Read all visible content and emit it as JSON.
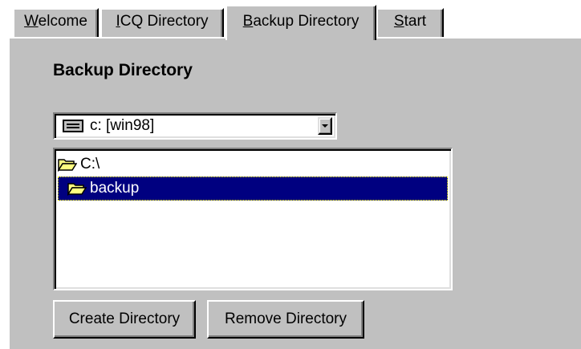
{
  "tabs": [
    {
      "label": "Welcome",
      "mnemonic": "W",
      "active": false
    },
    {
      "label": "ICQ Directory",
      "mnemonic": "I",
      "active": false
    },
    {
      "label": "Backup Directory",
      "mnemonic": "B",
      "active": true
    },
    {
      "label": "Start",
      "mnemonic": "S",
      "active": false
    }
  ],
  "page": {
    "title": "Backup Directory"
  },
  "drive_select": {
    "value": "c: [win98]",
    "icon": "drive-icon"
  },
  "folder_list": {
    "items": [
      {
        "label": "C:\\",
        "icon": "open-folder-icon",
        "selected": false
      },
      {
        "label": "backup",
        "icon": "open-folder-icon",
        "selected": true
      }
    ]
  },
  "buttons": {
    "create": "Create Directory",
    "remove": "Remove Directory"
  },
  "colors": {
    "window_bg": "#c0c0c0",
    "selection_bg": "#000080",
    "selection_fg": "#ffffff",
    "folder_yellow": "#ffff80"
  }
}
